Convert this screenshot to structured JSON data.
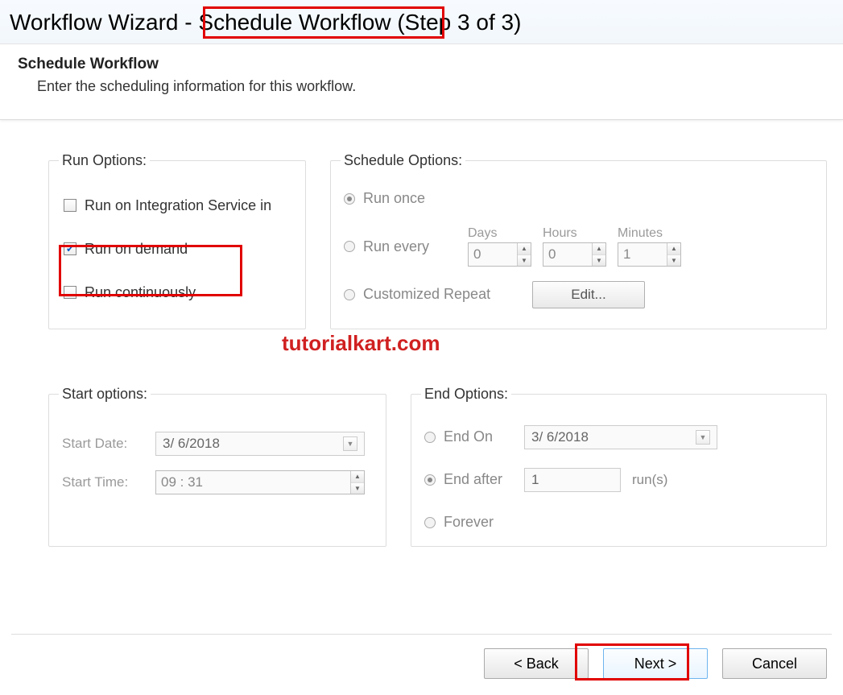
{
  "title": "Workflow Wizard - Schedule Workflow (Step 3 of 3)",
  "header": {
    "title": "Schedule Workflow",
    "subtitle": "Enter the scheduling information for this workflow."
  },
  "runOptions": {
    "legend": "Run Options:",
    "integration": {
      "label": "Run on Integration Service in",
      "checked": false
    },
    "onDemand": {
      "label": "Run on demand",
      "checked": true
    },
    "continuously": {
      "label": "Run continuously",
      "checked": false
    }
  },
  "scheduleOptions": {
    "legend": "Schedule Options:",
    "runOnce": {
      "label": "Run once",
      "selected": true
    },
    "runEvery": {
      "label": "Run every",
      "selected": false,
      "days": {
        "label": "Days",
        "value": "0"
      },
      "hours": {
        "label": "Hours",
        "value": "0"
      },
      "minutes": {
        "label": "Minutes",
        "value": "1"
      }
    },
    "customized": {
      "label": "Customized Repeat",
      "selected": false,
      "editLabel": "Edit..."
    }
  },
  "startOptions": {
    "legend": "Start options:",
    "date": {
      "label": "Start Date:",
      "value": "3/ 6/2018"
    },
    "time": {
      "label": "Start Time:",
      "value": "09 : 31"
    }
  },
  "endOptions": {
    "legend": "End Options:",
    "endOn": {
      "label": "End On",
      "selected": false,
      "value": "3/ 6/2018"
    },
    "endAfter": {
      "label": "End after",
      "selected": true,
      "value": "1",
      "unit": "run(s)"
    },
    "forever": {
      "label": "Forever",
      "selected": false
    }
  },
  "footer": {
    "back": "< Back",
    "next": "Next >",
    "cancel": "Cancel"
  },
  "watermark": "tutorialkart.com"
}
